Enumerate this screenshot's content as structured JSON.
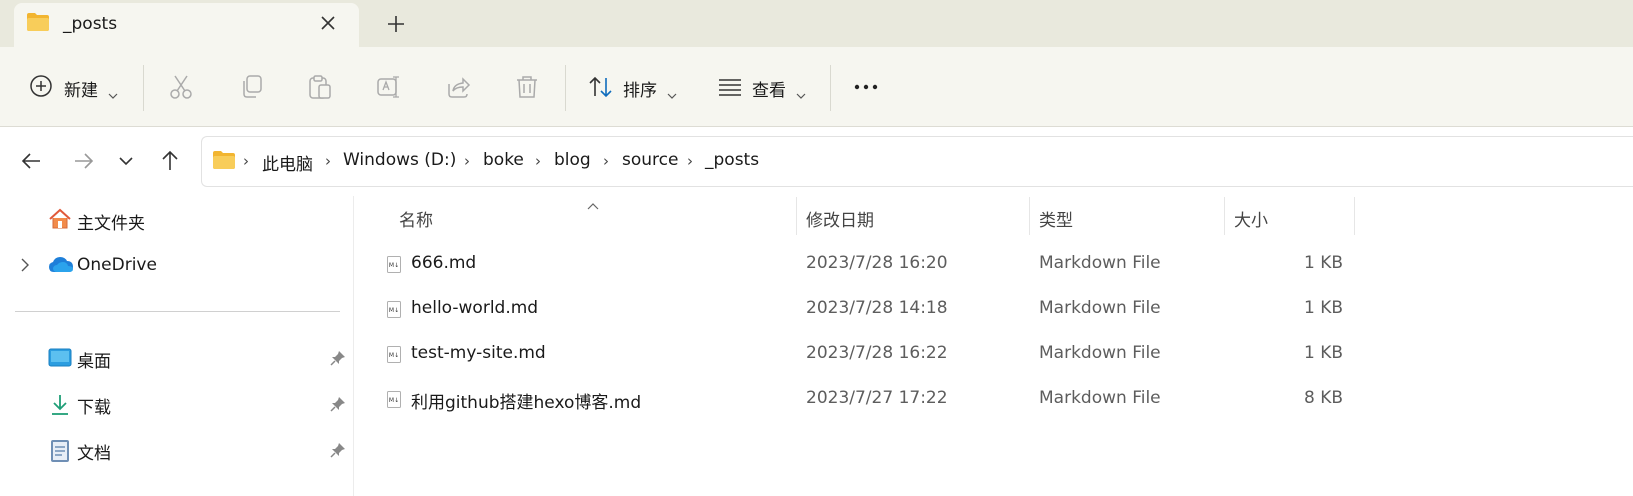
{
  "tab": {
    "title": "_posts"
  },
  "toolbar": {
    "new_label": "新建",
    "sort_label": "排序",
    "view_label": "查看",
    "actions": [
      "cut-icon",
      "copy-icon",
      "paste-icon",
      "rename-icon",
      "share-icon",
      "delete-icon"
    ]
  },
  "address": {
    "crumbs": [
      "此电脑",
      "Windows (D:)",
      "boke",
      "blog",
      "source",
      "_posts"
    ]
  },
  "sidebar": {
    "top": [
      {
        "label": "主文件夹",
        "icon": "home-icon"
      },
      {
        "label": "OneDrive",
        "icon": "onedrive-icon"
      }
    ],
    "pinned": [
      {
        "label": "桌面",
        "icon": "desktop-icon"
      },
      {
        "label": "下载",
        "icon": "download-icon"
      },
      {
        "label": "文档",
        "icon": "documents-icon"
      }
    ]
  },
  "columns": {
    "name": "名称",
    "date": "修改日期",
    "type": "类型",
    "size": "大小"
  },
  "files": [
    {
      "name": "666.md",
      "date": "2023/7/28 16:20",
      "type": "Markdown File",
      "size": "1 KB"
    },
    {
      "name": "hello-world.md",
      "date": "2023/7/28 14:18",
      "type": "Markdown File",
      "size": "1 KB"
    },
    {
      "name": "test-my-site.md",
      "date": "2023/7/28 16:22",
      "type": "Markdown File",
      "size": "1 KB"
    },
    {
      "name": "利用github搭建hexo博客.md",
      "date": "2023/7/27 17:22",
      "type": "Markdown File",
      "size": "8 KB"
    }
  ],
  "colors": {
    "folder": "#f5c24a",
    "accent": "#0f6cbd"
  }
}
